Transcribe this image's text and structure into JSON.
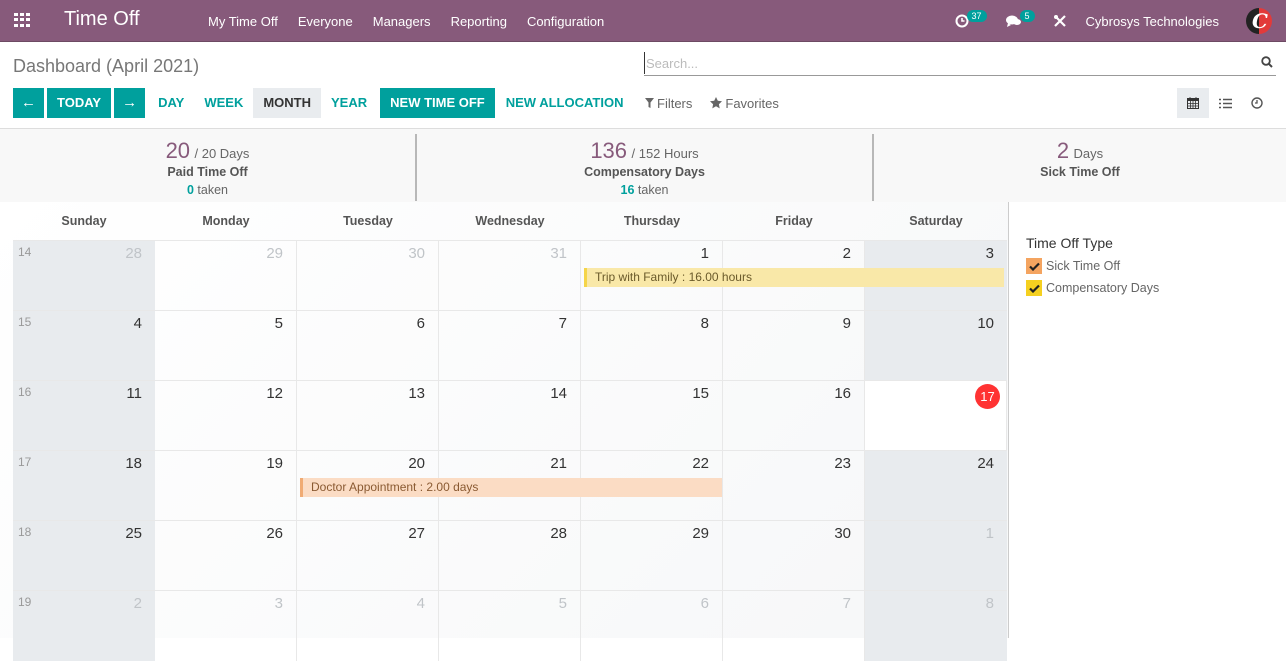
{
  "navbar": {
    "app_title": "Time Off",
    "menu": [
      "My Time Off",
      "Everyone",
      "Managers",
      "Reporting",
      "Configuration"
    ],
    "activity_count": "37",
    "message_count": "5",
    "company": "Cybrosys Technologies",
    "icons": {
      "apps": "apps-grid-icon",
      "activity": "clock-icon",
      "messages": "chat-icon",
      "debug": "tools-icon"
    }
  },
  "control_panel": {
    "breadcrumb": "Dashboard (April 2021)",
    "search": {
      "placeholder": "Search...",
      "value": ""
    },
    "buttons": {
      "prev": "←",
      "today": "Today",
      "next": "→",
      "day": "Day",
      "week": "Week",
      "month": "Month",
      "year": "Year",
      "new_time_off": "New Time Off",
      "new_allocation": "New Allocation"
    },
    "active_scale": "Month",
    "filters_label": "Filters",
    "favorites_label": "Favorites",
    "views": [
      "calendar",
      "list",
      "activity"
    ],
    "active_view": "calendar"
  },
  "stats": [
    {
      "value": "20",
      "unit": "/ 20 Days",
      "label": "Paid Time Off",
      "taken": "0",
      "taken_label": "taken"
    },
    {
      "value": "136",
      "unit": "/ 152 Hours",
      "label": "Compensatory Days",
      "taken": "16",
      "taken_label": "taken"
    },
    {
      "value": "2",
      "unit": "Days",
      "label": "Sick Time Off"
    }
  ],
  "calendar": {
    "weekdays": [
      "Sunday",
      "Monday",
      "Tuesday",
      "Wednesday",
      "Thursday",
      "Friday",
      "Saturday"
    ],
    "weeks": [
      {
        "wk": "14",
        "days": [
          "28",
          "29",
          "30",
          "31",
          "1",
          "2",
          "3"
        ]
      },
      {
        "wk": "15",
        "days": [
          "4",
          "5",
          "6",
          "7",
          "8",
          "9",
          "10"
        ]
      },
      {
        "wk": "16",
        "days": [
          "11",
          "12",
          "13",
          "14",
          "15",
          "16",
          "17"
        ]
      },
      {
        "wk": "17",
        "days": [
          "18",
          "19",
          "20",
          "21",
          "22",
          "23",
          "24"
        ]
      },
      {
        "wk": "18",
        "days": [
          "25",
          "26",
          "27",
          "28",
          "29",
          "30",
          "1"
        ]
      },
      {
        "wk": "19",
        "days": [
          "2",
          "3",
          "4",
          "5",
          "6",
          "7",
          "8"
        ]
      }
    ],
    "today": "17",
    "events": [
      {
        "title": "Trip with Family : 16.00 hours",
        "type": "Compensatory Days",
        "color": "#f9e8a8"
      },
      {
        "title": "Doctor Appointment : 2.00 days",
        "type": "Sick Time Off",
        "color": "#fbdcc4"
      }
    ]
  },
  "sidebar": {
    "title": "Time Off Type",
    "filters": [
      {
        "label": "Sick Time Off",
        "color": "#f4a460",
        "checked": true
      },
      {
        "label": "Compensatory Days",
        "color": "#f5d020",
        "checked": true
      }
    ]
  }
}
